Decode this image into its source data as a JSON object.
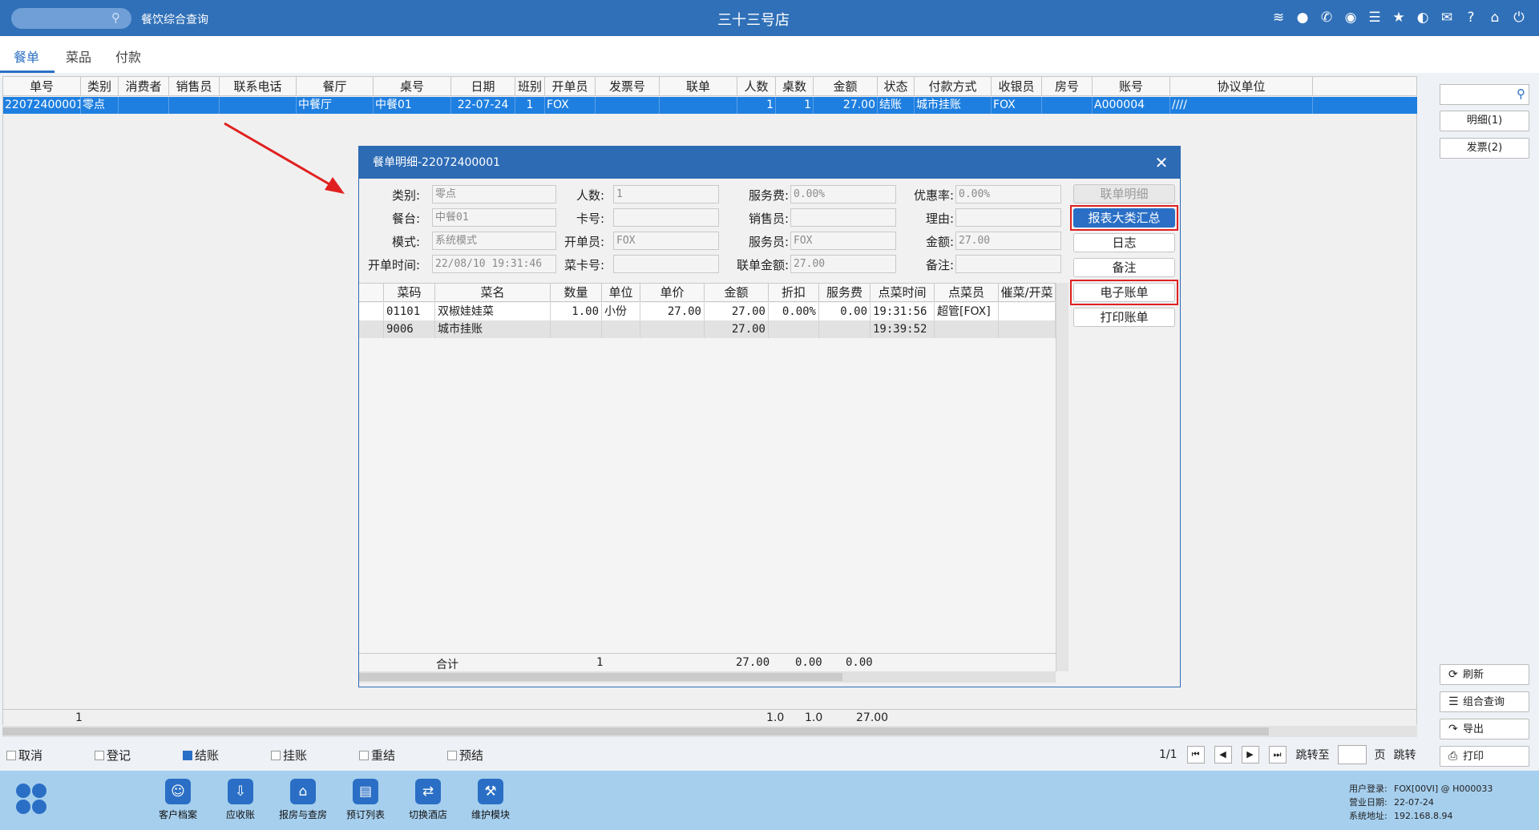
{
  "titlebar": {
    "app_title": "餐饮综合查询",
    "store_title": "三十三号店",
    "icons": [
      "wifi-icon",
      "chat-icon",
      "phone-icon",
      "palette-icon",
      "menu-icon",
      "star-icon",
      "theme-icon",
      "mail-icon",
      "help-icon",
      "home-icon",
      "power-icon"
    ]
  },
  "tabs": [
    {
      "label": "餐单",
      "active": true
    },
    {
      "label": "菜品",
      "active": false
    },
    {
      "label": "付款",
      "active": false
    }
  ],
  "grid": {
    "columns": [
      "单号",
      "类别",
      "消费者",
      "销售员",
      "联系电话",
      "餐厅",
      "桌号",
      "日期",
      "班别",
      "开单员",
      "发票号",
      "联单",
      "人数",
      "桌数",
      "金额",
      "状态",
      "付款方式",
      "收银员",
      "房号",
      "账号",
      "协议单位"
    ],
    "rows": [
      [
        "22072400001",
        "零点",
        "",
        "",
        "",
        "中餐厅",
        "中餐01",
        "22-07-24",
        "1",
        "FOX",
        "",
        "",
        "1",
        "1",
        "27.00",
        "结账",
        "城市挂账",
        "FOX",
        "",
        "A000004",
        "////"
      ]
    ],
    "footer": {
      "count": "1",
      "people": "1.0",
      "tables": "1.0",
      "amount": "27.00"
    }
  },
  "status_checks": [
    {
      "label": "取消",
      "checked": false
    },
    {
      "label": "登记",
      "checked": false
    },
    {
      "label": "结账",
      "checked": true
    },
    {
      "label": "挂账",
      "checked": false
    },
    {
      "label": "重结",
      "checked": false
    },
    {
      "label": "预结",
      "checked": false
    }
  ],
  "pager": {
    "page": "1/1",
    "goto_label": "跳转至",
    "page_unit": "页",
    "goto_button": "跳转"
  },
  "right_panel": {
    "detail_button": "明细(1)",
    "invoice_button": "发票(2)",
    "refresh_button": "刷新",
    "combo_query_button": "组合查询",
    "export_button": "导出",
    "print_button": "打印"
  },
  "dialog": {
    "title": "餐单明细-22072400001",
    "form": {
      "category_label": "类别:",
      "category_value": "零点",
      "table_label": "餐台:",
      "table_value": "中餐01",
      "mode_label": "模式:",
      "mode_value": "系统模式",
      "open_time_label": "开单时间:",
      "open_time_value": "22/08/10 19:31:46",
      "people_label": "人数:",
      "people_value": "1",
      "card_label": "卡号:",
      "card_value": "",
      "opener_label": "开单员:",
      "opener_value": "FOX",
      "menu_card_label": "菜卡号:",
      "menu_card_value": "",
      "service_fee_label": "服务费:",
      "service_fee_value": "0.00%",
      "seller_label": "销售员:",
      "seller_value": "",
      "waiter_label": "服务员:",
      "waiter_value": "FOX",
      "joint_amount_label": "联单金额:",
      "joint_amount_value": "27.00",
      "discount_rate_label": "优惠率:",
      "discount_rate_value": "0.00%",
      "reason_label": "理由:",
      "reason_value": "",
      "amount_label": "金额:",
      "amount_value": "27.00",
      "remark_label": "备注:",
      "remark_value": ""
    },
    "buttons": {
      "joint_detail": "联单明细",
      "category_summary": "报表大类汇总",
      "log": "日志",
      "remark": "备注",
      "e_bill": "电子账单",
      "print_bill": "打印账单"
    },
    "items": {
      "columns": [
        "菜码",
        "菜名",
        "数量",
        "单位",
        "单价",
        "金额",
        "折扣",
        "服务费",
        "点菜时间",
        "点菜员",
        "催菜/开菜"
      ],
      "rows": [
        [
          "01101",
          "双椒娃娃菜",
          "1.00",
          "小份",
          "27.00",
          "27.00",
          "0.00%",
          "0.00",
          "19:31:56",
          "超管[FOX]",
          ""
        ],
        [
          "9006",
          "城市挂账",
          "",
          "",
          "",
          "27.00",
          "",
          "",
          "19:39:52",
          "",
          ""
        ]
      ],
      "total": {
        "label": "合计",
        "qty": "1",
        "amount": "27.00",
        "discount": "0.00",
        "service": "0.00"
      }
    }
  },
  "taskbar": {
    "items": [
      {
        "label": "客户档案",
        "icon": "customer-icon"
      },
      {
        "label": "应收账",
        "icon": "receivable-icon"
      },
      {
        "label": "报房与查房",
        "icon": "room-icon"
      },
      {
        "label": "预订列表",
        "icon": "booking-icon"
      },
      {
        "label": "切换酒店",
        "icon": "switch-icon"
      },
      {
        "label": "维护模块",
        "icon": "wrench-icon"
      }
    ],
    "info": {
      "user_label": "用户登录:",
      "user_value": "FOX[00VI] @ H000033",
      "date_label": "营业日期:",
      "date_value": "22-07-24",
      "addr_label": "系统地址:",
      "addr_value": "192.168.8.94"
    }
  },
  "colors": {
    "accent": "#2a6fc5",
    "titlebar": "#3070b8",
    "selected_row": "#1e7fe0",
    "highlight": "#e02020",
    "taskbar": "#a6cfee"
  }
}
